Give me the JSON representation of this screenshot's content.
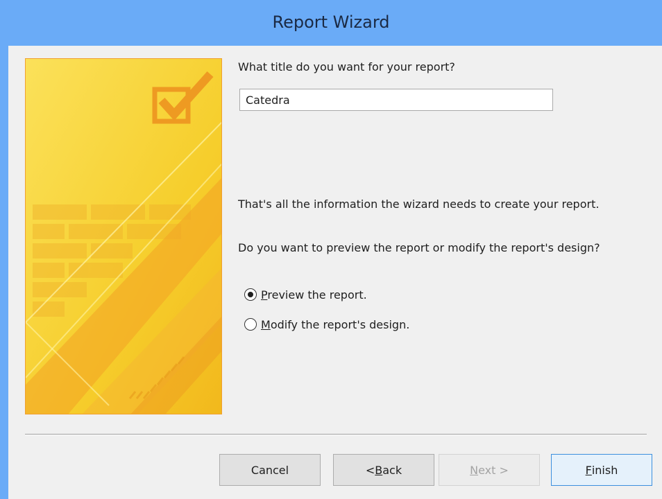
{
  "window": {
    "title": "Report Wizard"
  },
  "form": {
    "title_question": "What title do you want for your report?",
    "title_value": "Catedra",
    "info_text": "That's all the information the wizard needs to create your report.",
    "preview_question": "Do you want to preview the report or modify the report's design?",
    "options": [
      {
        "mnemonic": "P",
        "rest": "review the report.",
        "selected": true
      },
      {
        "mnemonic": "M",
        "rest": "odify the report's design.",
        "selected": false
      }
    ]
  },
  "buttons": {
    "cancel": {
      "label": "Cancel"
    },
    "back": {
      "prefix": "< ",
      "mnemonic": "B",
      "rest": "ack"
    },
    "next": {
      "mnemonic": "N",
      "rest": "ext >",
      "enabled": false
    },
    "finish": {
      "mnemonic": "F",
      "rest": "inish"
    }
  },
  "colors": {
    "title_bar": "#6aabf7",
    "art_background": "#f7d32a",
    "art_accent": "#f0a030"
  },
  "icons": {
    "art": "report-wizard-checkbox-art"
  }
}
